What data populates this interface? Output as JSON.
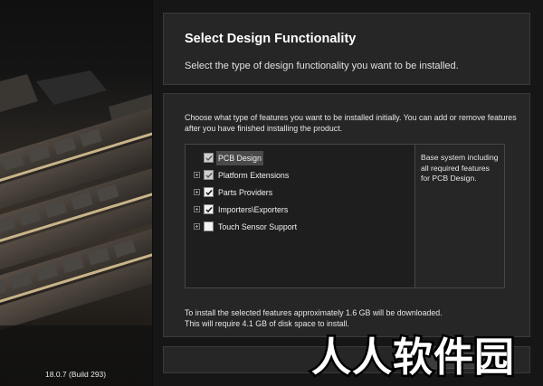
{
  "version": "18.0.7 (Build 293)",
  "header": {
    "title": "Select Design Functionality",
    "subtitle": "Select the type of design functionality you want to be installed."
  },
  "panel": {
    "intro": "Choose what type of features you want to be installed initially. You can add or remove features after you have finished installing the product.",
    "features": [
      {
        "label": "PCB Design",
        "checked": true,
        "greyed": true,
        "expandable": false,
        "selected": true
      },
      {
        "label": "Platform Extensions",
        "checked": true,
        "greyed": true,
        "expandable": true,
        "selected": false
      },
      {
        "label": "Parts Providers",
        "checked": true,
        "greyed": false,
        "expandable": true,
        "selected": false
      },
      {
        "label": "Importers\\Exporters",
        "checked": true,
        "greyed": false,
        "expandable": true,
        "selected": false
      },
      {
        "label": "Touch Sensor Support",
        "checked": false,
        "greyed": false,
        "expandable": true,
        "selected": false
      }
    ],
    "description": "Base system including all required features for PCB Design.",
    "footnote_line1": "To install the selected features approximately 1.6 GB will be downloaded.",
    "footnote_line2": "This will require 4.1 GB of disk space to install."
  },
  "watermark": "人人软件园",
  "icons": {
    "expander": "plus-box-icon",
    "check": "checkmark-icon",
    "scroll_up": "chevron-up-icon",
    "scroll_down": "chevron-down-icon"
  },
  "colors": {
    "background": "#161616",
    "panel": "#262626",
    "selected_row": "#4a4a4a"
  }
}
